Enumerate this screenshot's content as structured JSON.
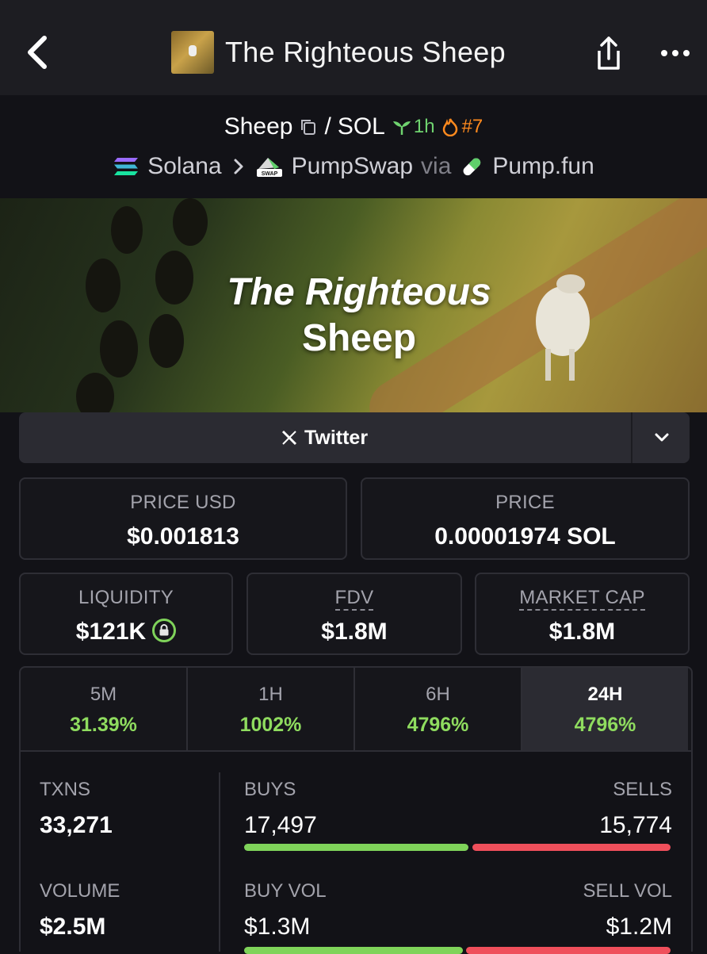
{
  "header": {
    "title": "The Righteous Sheep"
  },
  "pair": {
    "base": "Sheep",
    "separator": "/",
    "quote": "SOL",
    "age": "1h",
    "rank": "#7",
    "chain": "Solana",
    "dex": "PumpSwap",
    "via_label": "via",
    "launchpad": "Pump.fun"
  },
  "banner": {
    "line1": "The Righteous",
    "line2": "Sheep"
  },
  "links": {
    "twitter_label": "Twitter"
  },
  "price": {
    "usd_label": "PRICE USD",
    "usd_value": "$0.001813",
    "native_label": "PRICE",
    "native_value": "0.00001974 SOL"
  },
  "metrics": {
    "liquidity_label": "LIQUIDITY",
    "liquidity_value": "$121K",
    "fdv_label": "FDV",
    "fdv_value": "$1.8M",
    "mcap_label": "MARKET CAP",
    "mcap_value": "$1.8M"
  },
  "timeframes": [
    {
      "label": "5M",
      "value": "31.39%"
    },
    {
      "label": "1H",
      "value": "1002%"
    },
    {
      "label": "6H",
      "value": "4796%"
    },
    {
      "label": "24H",
      "value": "4796%"
    }
  ],
  "stats": {
    "txns_label": "TXNS",
    "txns_value": "33,271",
    "buys_label": "BUYS",
    "buys_value": "17,497",
    "sells_label": "SELLS",
    "sells_value": "15,774",
    "volume_label": "VOLUME",
    "volume_value": "$2.5M",
    "buy_vol_label": "BUY VOL",
    "buy_vol_value": "$1.3M",
    "sell_vol_label": "SELL VOL",
    "sell_vol_value": "$1.2M"
  },
  "colors": {
    "positive": "#8fdc5f",
    "buy_bar": "#7fd35a",
    "sell_bar": "#ef4f5b",
    "rank": "#ff8a1e"
  }
}
